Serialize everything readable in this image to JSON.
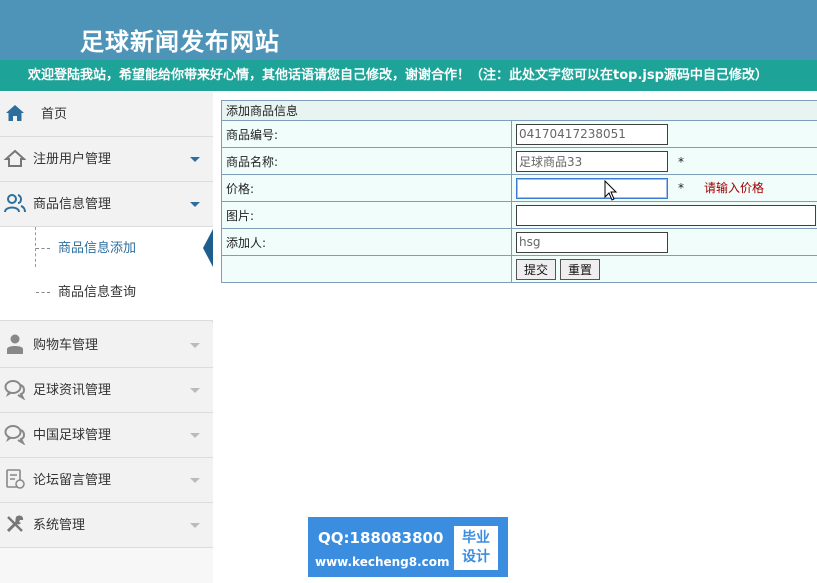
{
  "header": {
    "site_title": "足球新闻发布网站",
    "marquee": "欢迎登陆我站，希望能给你带来好心情，其他话语请您自己修改，谢谢合作！（注：此处文字您可以在top.jsp源码中自己修改）"
  },
  "sidebar": {
    "home": "首页",
    "items": [
      {
        "label": "注册用户管理",
        "icon": "home-outline-icon"
      },
      {
        "label": "商品信息管理",
        "icon": "users-icon"
      },
      {
        "label": "购物车管理",
        "icon": "person-icon"
      },
      {
        "label": "足球资讯管理",
        "icon": "chat-bubbles-icon"
      },
      {
        "label": "中国足球管理",
        "icon": "chat-bubbles-icon"
      },
      {
        "label": "论坛留言管理",
        "icon": "document-icon"
      },
      {
        "label": "系统管理",
        "icon": "tools-icon"
      }
    ],
    "submenu": [
      {
        "label": "商品信息添加",
        "active": true
      },
      {
        "label": "商品信息查询",
        "active": false
      }
    ],
    "accent_color": "#1f5f8e"
  },
  "form": {
    "caption": "添加商品信息",
    "rows": {
      "code": {
        "label": "商品编号:",
        "value": "04170417238051"
      },
      "name": {
        "label": "商品名称:",
        "value": "足球商品33",
        "required": "*"
      },
      "price": {
        "label": "价格:",
        "value": "",
        "required": "*",
        "error": "请输入价格"
      },
      "image": {
        "label": "图片:",
        "value": ""
      },
      "adder": {
        "label": "添加人:",
        "value": "hsg"
      }
    },
    "submit_label": "提交",
    "reset_label": "重置"
  },
  "watermark": {
    "qq": "QQ:188083800",
    "url": "www.kecheng8.com",
    "badge_line1": "毕业",
    "badge_line2": "设计"
  }
}
